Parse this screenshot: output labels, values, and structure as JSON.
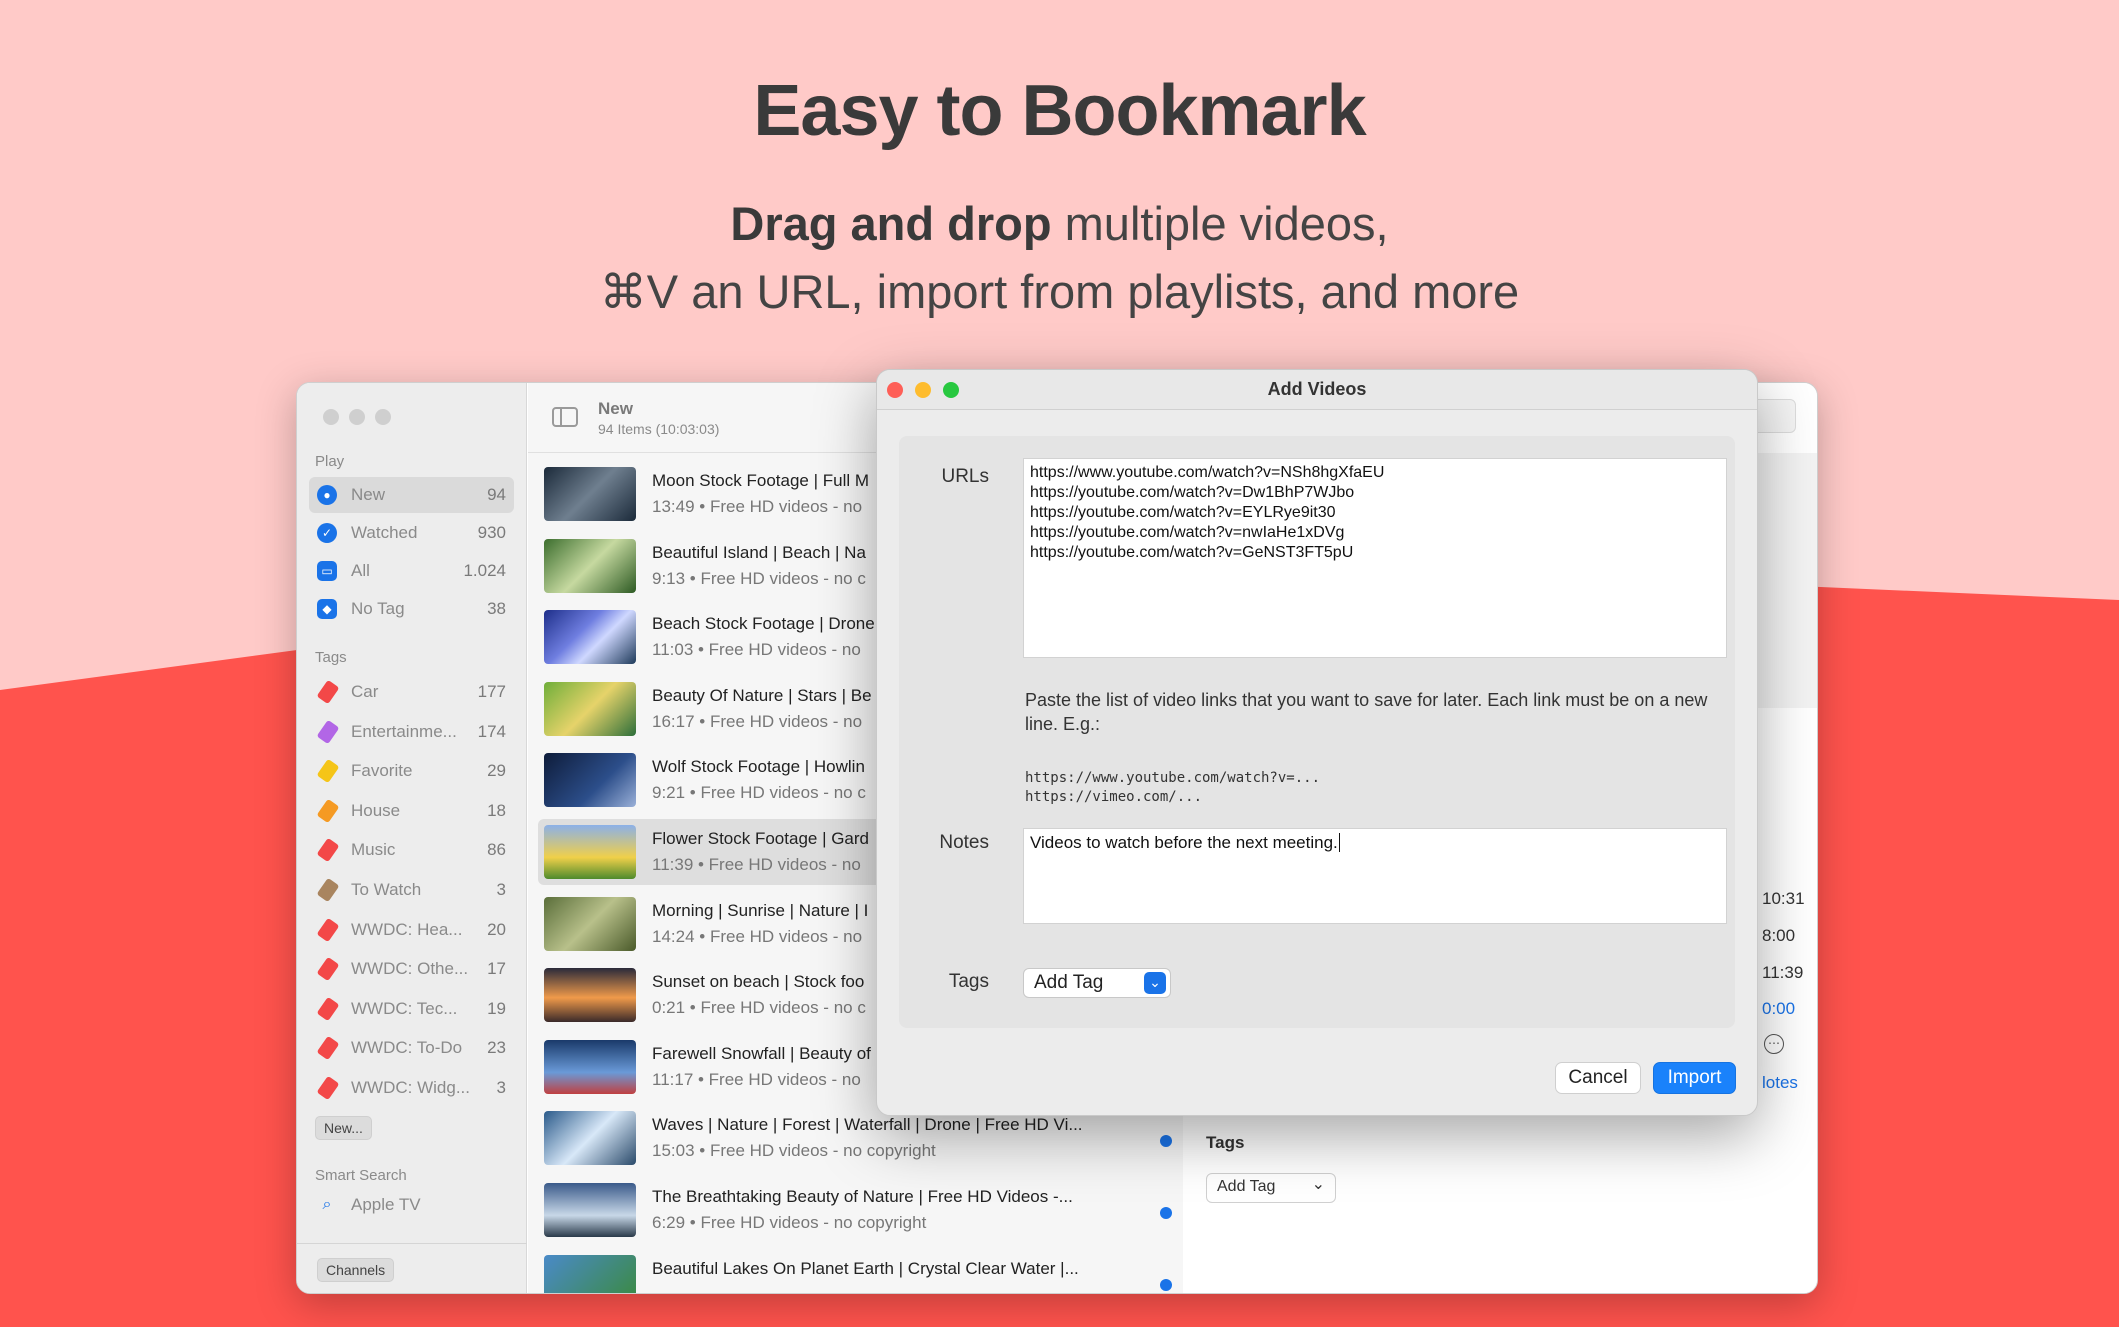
{
  "hero": {
    "title": "Easy to Bookmark",
    "line1_bold": "Drag and drop",
    "line1_rest": " multiple videos,",
    "line2": "⌘V an URL, import from playlists, and more"
  },
  "colors": {
    "bg_pink": "#ffcac8",
    "bg_red": "#ff534d",
    "accent": "#1a82fb"
  },
  "sidebar": {
    "play_header": "Play",
    "play_items": [
      {
        "label": "New",
        "count": "94",
        "icon": "new-icon"
      },
      {
        "label": "Watched",
        "count": "930",
        "icon": "check-icon"
      },
      {
        "label": "All",
        "count": "1.024",
        "icon": "tray-icon"
      },
      {
        "label": "No Tag",
        "count": "38",
        "icon": "no-tag-icon"
      }
    ],
    "tags_header": "Tags",
    "tags": [
      {
        "label": "Car",
        "count": "177",
        "color": "#f34848"
      },
      {
        "label": "Entertainme...",
        "count": "174",
        "color": "#b266e6"
      },
      {
        "label": "Favorite",
        "count": "29",
        "color": "#f5c518"
      },
      {
        "label": "House",
        "count": "18",
        "color": "#f59a23"
      },
      {
        "label": "Music",
        "count": "86",
        "color": "#f34848"
      },
      {
        "label": "To Watch",
        "count": "3",
        "color": "#a9855f"
      },
      {
        "label": "WWDC: Hea...",
        "count": "20",
        "color": "#f34848"
      },
      {
        "label": "WWDC: Othe...",
        "count": "17",
        "color": "#f34848"
      },
      {
        "label": "WWDC: Tec...",
        "count": "19",
        "color": "#f34848"
      },
      {
        "label": "WWDC: To-Do",
        "count": "23",
        "color": "#f34848"
      },
      {
        "label": "WWDC: Widg...",
        "count": "3",
        "color": "#f34848"
      }
    ],
    "new_button": "New...",
    "smart_header": "Smart Search",
    "smart_items": [
      {
        "label": "Apple TV",
        "icon": "search-icon"
      }
    ],
    "channels_button": "Channels"
  },
  "list": {
    "title": "New",
    "subtitle": "94 Items (10:03:03)",
    "videos": [
      {
        "title": "Moon Stock Footage | Full M",
        "sub": "13:49 • Free HD videos - no",
        "dot": false
      },
      {
        "title": "Beautiful Island | Beach | Na",
        "sub": "9:13 • Free HD videos - no c",
        "dot": false
      },
      {
        "title": "Beach Stock Footage | Drone",
        "sub": "11:03 • Free HD videos - no",
        "dot": false
      },
      {
        "title": "Beauty Of Nature | Stars | Be",
        "sub": "16:17 • Free HD videos - no",
        "dot": false
      },
      {
        "title": "Wolf Stock Footage | Howlin",
        "sub": "9:21 • Free HD videos - no c",
        "dot": false
      },
      {
        "title": "Flower Stock Footage | Gard",
        "sub": "11:39 • Free HD videos - no",
        "dot": false
      },
      {
        "title": "Morning | Sunrise | Nature | I",
        "sub": "14:24 • Free HD videos - no",
        "dot": false
      },
      {
        "title": "Sunset on beach | Stock foo",
        "sub": "0:21 • Free HD videos - no c",
        "dot": false
      },
      {
        "title": "Farewell Snowfall | Beauty of",
        "sub": "11:17 • Free HD videos - no",
        "dot": false
      },
      {
        "title": "Waves | Nature | Forest | Waterfall | Drone | Free HD Vi...",
        "sub": "15:03 • Free HD videos - no copyright",
        "dot": true
      },
      {
        "title": "The Breathtaking Beauty of Nature | Free HD Videos -...",
        "sub": "6:29 • Free HD videos - no copyright",
        "dot": true
      },
      {
        "title": "Beautiful Lakes On Planet Earth | Crystal Clear Water |...",
        "sub": "",
        "dot": true
      }
    ]
  },
  "detail": {
    "times": [
      "10:31",
      "8:00",
      "11:39",
      "0:00"
    ],
    "notes_link": "lotes",
    "tags_label": "Tags",
    "add_tag": "Add Tag"
  },
  "dialog": {
    "title": "Add Videos",
    "urls_label": "URLs",
    "urls": [
      "https://www.youtube.com/watch?v=NSh8hgXfaEU",
      "https://youtube.com/watch?v=Dw1BhP7WJbo",
      "https://youtube.com/watch?v=EYLRye9it30",
      "https://youtube.com/watch?v=nwIaHe1xDVg",
      "https://youtube.com/watch?v=GeNST3FT5pU"
    ],
    "help_text": "Paste the list of video links that you want to save for later. Each link must be on a new line. E.g.:",
    "example1": "https://www.youtube.com/watch?v=...",
    "example2": "https://vimeo.com/...",
    "notes_label": "Notes",
    "notes_value": "Videos to watch before the next meeting.",
    "tags_label": "Tags",
    "tag_select": "Add Tag",
    "cancel": "Cancel",
    "import": "Import"
  }
}
